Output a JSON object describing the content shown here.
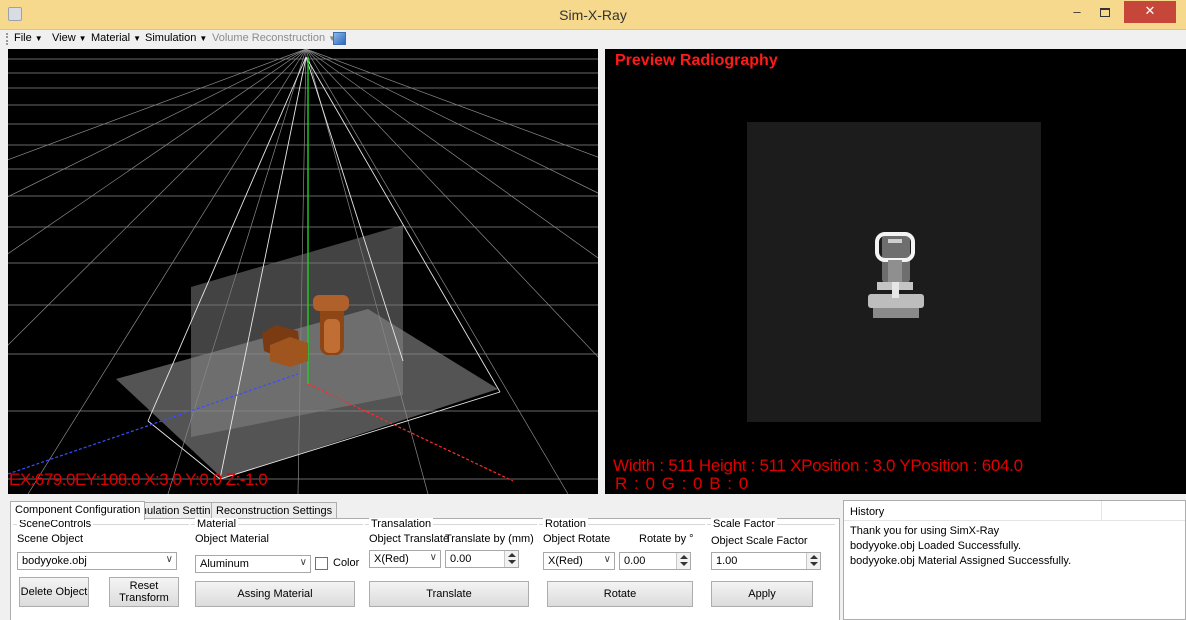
{
  "window": {
    "title": "Sim-X-Ray"
  },
  "menu": {
    "items": [
      {
        "label": "File",
        "enabled": true
      },
      {
        "label": "View",
        "enabled": true
      },
      {
        "label": "Material",
        "enabled": true
      },
      {
        "label": "Simulation",
        "enabled": true
      },
      {
        "label": "Volume Reconstruction",
        "enabled": false
      }
    ]
  },
  "viewport": {
    "status": "EX:679.0EY:108.0 X:3.0 Y:0.0 Z:-1.0"
  },
  "preview": {
    "title": "Preview Radiography",
    "info": "Width : 511  Height : 511  XPosition : 3.0  YPosition : 604.0",
    "rgb": "R : 0  G : 0  B : 0"
  },
  "tabs": [
    "Component Configuration",
    "Simulation Settings",
    "Reconstruction Settings"
  ],
  "scene_controls": {
    "title": "SceneControls",
    "object_label": "Scene Object",
    "object_value": "bodyyoke.obj",
    "delete_button": "Delete Object",
    "reset_button": "Reset Transform"
  },
  "material": {
    "title": "Material",
    "label": "Object Material",
    "value": "Aluminum",
    "color_label": "Color",
    "color_checked": false,
    "assign_button": "Assing Material"
  },
  "translation": {
    "title": "Transalation",
    "axis_label": "Object Translate",
    "amount_label": "Translate by (mm)",
    "axis_value": "X(Red)",
    "amount_value": "0.00",
    "button": "Translate"
  },
  "rotation": {
    "title": "Rotation",
    "axis_label": "Object Rotate",
    "amount_label": "Rotate  by °",
    "axis_value": "X(Red)",
    "amount_value": "0.00",
    "button": "Rotate"
  },
  "scale": {
    "title": "Scale Factor",
    "label": "Object Scale Factor",
    "value": "1.00",
    "button": "Apply"
  },
  "history": {
    "header": "History",
    "lines": [
      "Thank you for using SimX-Ray",
      "bodyyoke.obj Loaded Successfully.",
      "bodyyoke.obj Material Assigned Successfully."
    ]
  },
  "colors": {
    "titlebar": "#f7d98e",
    "close": "#c7463a",
    "overlay_text": "#e00000",
    "object": "#8b4a1c"
  }
}
